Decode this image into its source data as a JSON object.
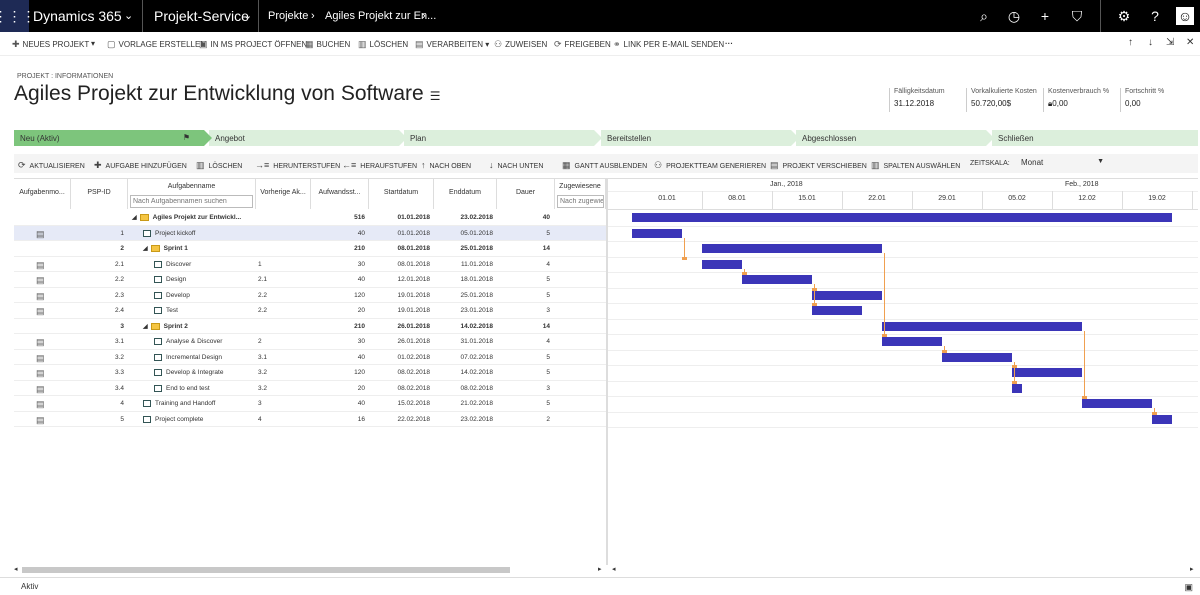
{
  "navbar": {
    "brand": "Dynamics 365",
    "app": "Projekt-Service",
    "breadcrumb": [
      "Projekte",
      "Agiles Projekt zur En..."
    ],
    "icons": [
      "search-icon",
      "history-icon",
      "plus-icon",
      "filter-icon",
      "gear-icon",
      "help-icon",
      "user-icon"
    ]
  },
  "commands": [
    {
      "label": "Neues Projekt",
      "icon": "+"
    },
    {
      "label": "Vorlage erstellen",
      "icon": "▢"
    },
    {
      "label": "In MS Project öffnen",
      "icon": "▣"
    },
    {
      "label": "Buchen",
      "icon": "▦"
    },
    {
      "label": "Löschen",
      "icon": "🗑"
    },
    {
      "label": "Verarbeiten",
      "icon": "▤"
    },
    {
      "label": "Zuweisen",
      "icon": "👥"
    },
    {
      "label": "Freigeben",
      "icon": "⟳"
    },
    {
      "label": "Link per E-Mail senden",
      "icon": "⚭"
    },
    {
      "label": "···",
      "icon": ""
    }
  ],
  "header": {
    "entity_label": "PROJEKT : INFORMATIONEN",
    "title": "Agiles Projekt zur Entwicklung von Software",
    "fields": [
      {
        "label": "Fälligkeitsdatum",
        "value": "31.12.2018"
      },
      {
        "label": "Vorkalkulierte Kosten",
        "value": "50.720,00$"
      },
      {
        "label": "Kostenverbrauch %",
        "value": "0,00"
      },
      {
        "label": "Fortschritt %",
        "value": "0,00"
      }
    ]
  },
  "stages": [
    "Neu (Aktiv)",
    "Angebot",
    "Plan",
    "Bereitstellen",
    "Abgeschlossen",
    "Schließen"
  ],
  "toolbar": {
    "items": [
      {
        "label": "Aktualisieren",
        "icon": "⟳"
      },
      {
        "label": "Aufgabe hinzufügen",
        "icon": "+"
      },
      {
        "label": "Löschen",
        "icon": "🗑"
      },
      {
        "label": "Herunterstufen",
        "icon": "→≡"
      },
      {
        "label": "Heraufstufen",
        "icon": "←≡"
      },
      {
        "label": "Nach oben",
        "icon": "↑"
      },
      {
        "label": "Nach unten",
        "icon": "↓"
      },
      {
        "label": "Gantt ausblenden",
        "icon": "▦"
      },
      {
        "label": "Projektteam generieren",
        "icon": "⚇"
      },
      {
        "label": "Projekt verschieben",
        "icon": "▤"
      },
      {
        "label": "Spalten auswählen",
        "icon": "▥"
      }
    ],
    "timescale_label": "ZEITSKALA:",
    "timescale_value": "Monat"
  },
  "grid": {
    "columns": [
      "Aufgabenmo...",
      "PSP-ID",
      "Aufgabenname",
      "Vorherige Ak...",
      "Aufwandsst...",
      "Startdatum",
      "Enddatum",
      "Dauer",
      "Zugewiesene"
    ],
    "search_placeholder": "Nach Aufgabennamen suchen",
    "assigned_placeholder": "Nach zugewie",
    "rows": [
      {
        "mode": "",
        "psp": "",
        "name": "Agiles Projekt zur Entwickl...",
        "pred": "",
        "effort": "516",
        "start": "01.01.2018",
        "end": "23.02.2018",
        "dur": "40",
        "level": 0,
        "summary": true
      },
      {
        "mode": "task",
        "psp": "1",
        "name": "Project kickoff",
        "pred": "",
        "effort": "40",
        "start": "01.01.2018",
        "end": "05.01.2018",
        "dur": "5",
        "level": 1,
        "summary": false
      },
      {
        "mode": "",
        "psp": "2",
        "name": "Sprint 1",
        "pred": "",
        "effort": "210",
        "start": "08.01.2018",
        "end": "25.01.2018",
        "dur": "14",
        "level": 1,
        "summary": true
      },
      {
        "mode": "task",
        "psp": "2.1",
        "name": "Discover",
        "pred": "1",
        "effort": "30",
        "start": "08.01.2018",
        "end": "11.01.2018",
        "dur": "4",
        "level": 2,
        "summary": false
      },
      {
        "mode": "task",
        "psp": "2.2",
        "name": "Design",
        "pred": "2.1",
        "effort": "40",
        "start": "12.01.2018",
        "end": "18.01.2018",
        "dur": "5",
        "level": 2,
        "summary": false
      },
      {
        "mode": "task",
        "psp": "2.3",
        "name": "Develop",
        "pred": "2.2",
        "effort": "120",
        "start": "19.01.2018",
        "end": "25.01.2018",
        "dur": "5",
        "level": 2,
        "summary": false
      },
      {
        "mode": "task",
        "psp": "2.4",
        "name": "Test",
        "pred": "2.2",
        "effort": "20",
        "start": "19.01.2018",
        "end": "23.01.2018",
        "dur": "3",
        "level": 2,
        "summary": false
      },
      {
        "mode": "",
        "psp": "3",
        "name": "Sprint 2",
        "pred": "",
        "effort": "210",
        "start": "26.01.2018",
        "end": "14.02.2018",
        "dur": "14",
        "level": 1,
        "summary": true
      },
      {
        "mode": "task",
        "psp": "3.1",
        "name": "Analyse & Discover",
        "pred": "2",
        "effort": "30",
        "start": "26.01.2018",
        "end": "31.01.2018",
        "dur": "4",
        "level": 2,
        "summary": false
      },
      {
        "mode": "task",
        "psp": "3.2",
        "name": "Incremental Design",
        "pred": "3.1",
        "effort": "40",
        "start": "01.02.2018",
        "end": "07.02.2018",
        "dur": "5",
        "level": 2,
        "summary": false
      },
      {
        "mode": "task",
        "psp": "3.3",
        "name": "Develop & Integrate",
        "pred": "3.2",
        "effort": "120",
        "start": "08.02.2018",
        "end": "14.02.2018",
        "dur": "5",
        "level": 2,
        "summary": false
      },
      {
        "mode": "task",
        "psp": "3.4",
        "name": "End to end test",
        "pred": "3.2",
        "effort": "20",
        "start": "08.02.2018",
        "end": "08.02.2018",
        "dur": "3",
        "level": 2,
        "summary": false
      },
      {
        "mode": "task",
        "psp": "4",
        "name": "Training and Handoff",
        "pred": "3",
        "effort": "40",
        "start": "15.02.2018",
        "end": "21.02.2018",
        "dur": "5",
        "level": 1,
        "summary": false
      },
      {
        "mode": "task",
        "psp": "5",
        "name": "Project complete",
        "pred": "4",
        "effort": "16",
        "start": "22.02.2018",
        "end": "23.02.2018",
        "dur": "2",
        "level": 1,
        "summary": false
      }
    ]
  },
  "gantt": {
    "months": [
      "Jan., 2018",
      "Feb., 2018"
    ],
    "ticks": [
      "01.01",
      "08.01",
      "15.01",
      "22.01",
      "29.01",
      "05.02",
      "12.02",
      "19.02"
    ]
  },
  "status": {
    "text": "Aktiv"
  }
}
